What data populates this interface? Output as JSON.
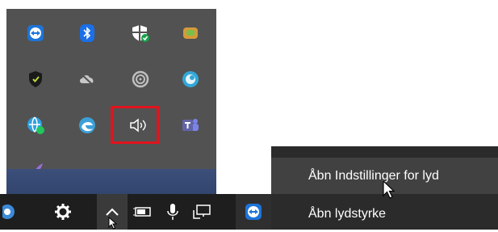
{
  "tray": {
    "icons": [
      {
        "name": "teamviewer-icon",
        "color": "#1e74d8"
      },
      {
        "name": "bluetooth-icon",
        "color": "#1b6fe8"
      },
      {
        "name": "windows-security-icon",
        "color": "#ffffff"
      },
      {
        "name": "app-cube-icon",
        "color": "#d69a3a"
      },
      {
        "name": "shield-green-icon",
        "color": "#2b2b2b"
      },
      {
        "name": "cloud-offline-icon",
        "color": "#c8c8c8"
      },
      {
        "name": "spiral-app-icon",
        "color": "#bfbfbf"
      },
      {
        "name": "circle-app-icon",
        "color": "#31a8d8"
      },
      {
        "name": "remote-globe-icon",
        "color": "#2fa0e0"
      },
      {
        "name": "edge-icon",
        "color": "#3ca0d8"
      },
      {
        "name": "speaker-volume-icon",
        "color": "#ffffff"
      },
      {
        "name": "teams-icon",
        "color": "#6264a7"
      },
      {
        "name": "feather-icon",
        "color": "#9b6fd8"
      }
    ],
    "highlight_color": "#e0141e"
  },
  "taskbar": {
    "icons": [
      "chrome-partial-icon",
      "gear-icon",
      "chevron-up-icon",
      "battery-icon",
      "microphone-icon",
      "network-icon"
    ]
  },
  "context_menu": {
    "items": [
      {
        "label": "Åbn Indstillinger for lyd"
      },
      {
        "label": "Åbn lydstyrke"
      }
    ]
  }
}
